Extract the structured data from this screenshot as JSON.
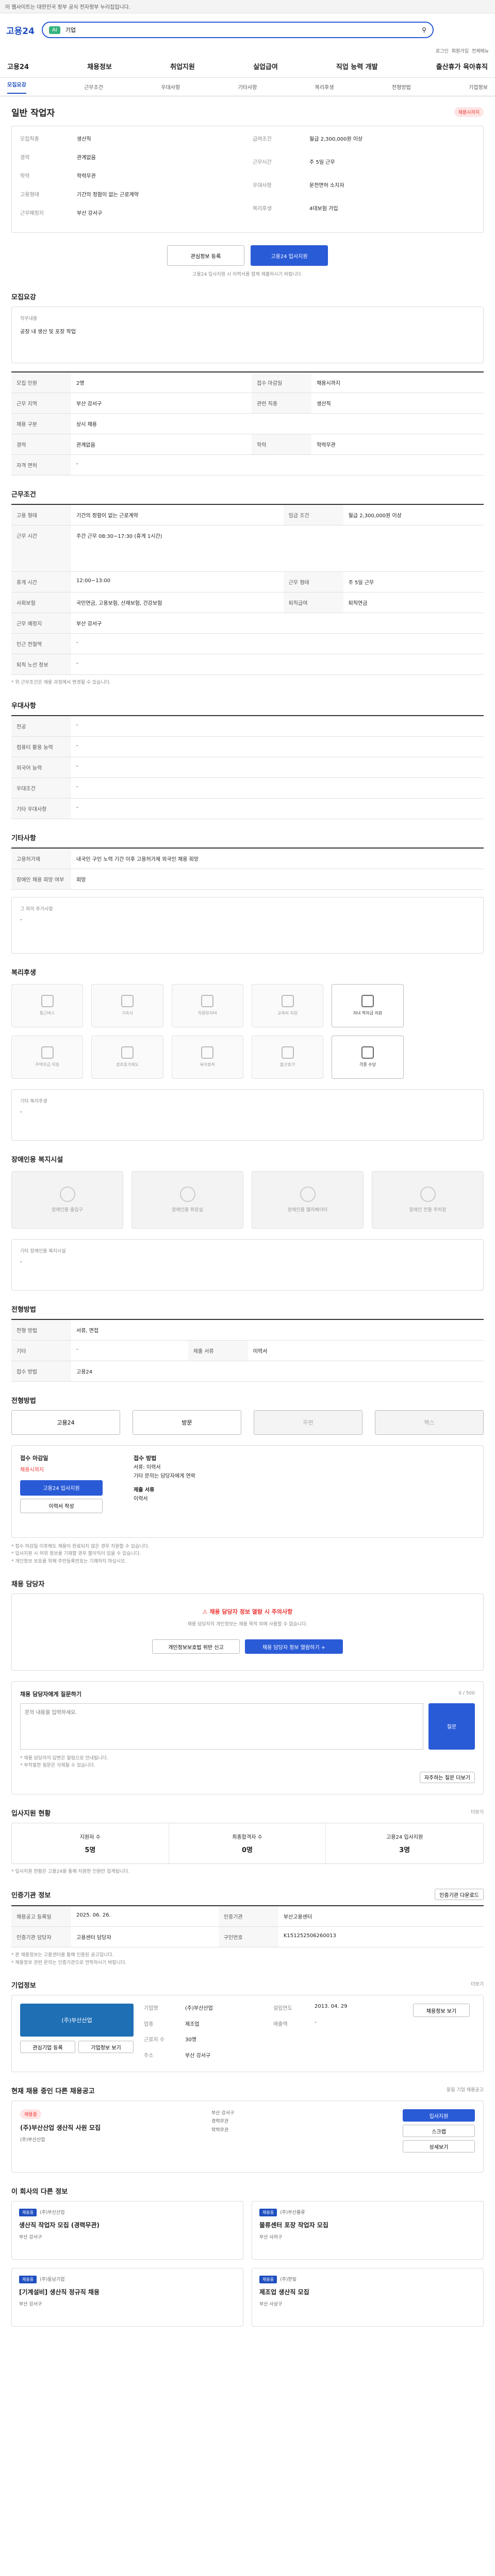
{
  "topbar": {
    "text": "이 웹사이트는 대한민국 정부 공식 전자정부 누리집입니다."
  },
  "header": {
    "logo": "고용24",
    "search_badge": "AI",
    "search_value": "기업",
    "links": [
      "로그인",
      "회원가입",
      "전체메뉴"
    ]
  },
  "nav": [
    "고용24",
    "채용정보",
    "취업지원",
    "실업급여",
    "직업 능력 개발",
    "출산휴가 육아휴직"
  ],
  "tabs": [
    "모집요강",
    "근무조건",
    "우대사항",
    "기타사항",
    "복리후생",
    "전형방법",
    "기업정보"
  ],
  "title": {
    "section": "모집요강",
    "job": "일반 작업자",
    "badge": "채용시까지"
  },
  "summary": {
    "left": [
      {
        "k": "모집직종",
        "v": "생산직"
      },
      {
        "k": "경력",
        "v": "관계없음"
      },
      {
        "k": "학력",
        "v": "학력무관"
      },
      {
        "k": "고용형태",
        "v": "기간의 정함이 없는 근로계약"
      },
      {
        "k": "근무예정지",
        "v": "부산 강서구"
      }
    ],
    "right": [
      {
        "k": "급여조건",
        "v": "월급 2,300,000원 이상"
      },
      {
        "k": "근무시간",
        "v": "주 5일 근무"
      },
      {
        "k": "우대사항",
        "v": "운전면허 소지자"
      },
      {
        "k": "복리후생",
        "v": "4대보험 가입"
      }
    ]
  },
  "actions": {
    "scrap": "관심정보 등록",
    "apply": "고용24 입사지원",
    "note": "고용24 입사지원 시 이력서를 함께 제출하시기 바랍니다."
  },
  "recruit": {
    "section": "모집요강",
    "rows": [
      {
        "k": "직무내용",
        "v": "공장 내 생산 및 포장 작업"
      },
      {
        "k": "모집 인원",
        "v": "2명"
      },
      {
        "k": "접수 마감일",
        "v": "채용시까지"
      },
      {
        "k": "근무 지역",
        "v": "부산 강서구"
      },
      {
        "k": "관련 직종",
        "v": "생산직"
      },
      {
        "k": "채용 구분",
        "v": "상시 채용"
      },
      {
        "k": "경력",
        "v": "관계없음"
      },
      {
        "k": "학력",
        "v": "학력무관"
      },
      {
        "k": "자격 면허",
        "v": "-"
      }
    ]
  },
  "work": {
    "section": "근무조건",
    "rows": [
      {
        "k": "고용 형태",
        "v": "기간의 정함이 없는 근로계약"
      },
      {
        "k": "임금 조건",
        "v": "월급 2,300,000원 이상"
      },
      {
        "k": "근무 시간",
        "v": "주간 근무 08:30~17:30 (휴게 1시간)"
      },
      {
        "k": "휴게 시간",
        "v": "12:00~13:00"
      },
      {
        "k": "근무 형태",
        "v": "주 5일 근무"
      },
      {
        "k": "사회보험",
        "v": "국민연금, 고용보험, 산재보험, 건강보험"
      },
      {
        "k": "퇴직급여",
        "v": "퇴직연금"
      },
      {
        "k": "근무 예정지",
        "v": "부산 강서구"
      },
      {
        "k": "인근 전철역",
        "v": "-"
      },
      {
        "k": "퇴직 노선 정보",
        "v": "-"
      }
    ],
    "note": "* 위 근무조건은 채용 과정에서 변경될 수 있습니다."
  },
  "prefer": {
    "section": "우대사항",
    "rows": [
      {
        "k": "전공",
        "v": "-"
      },
      {
        "k": "컴퓨터 활용 능력",
        "v": "-"
      },
      {
        "k": "외국어 능력",
        "v": "-"
      },
      {
        "k": "우대조건",
        "v": "-"
      },
      {
        "k": "기타 우대사항",
        "v": "-"
      }
    ]
  },
  "etc": {
    "section": "기타사항",
    "rows": [
      {
        "k": "고용허가제",
        "v": "내국인 구인 노력 기간 이후 고용허가제 외국인 채용 희망"
      },
      {
        "k": "장애인 채용 희망 여부",
        "v": "희망"
      }
    ],
    "other_label": "그 외의 추가사항",
    "other_value": "-"
  },
  "welfare": {
    "section": "복리후생",
    "items": [
      "통근버스",
      "기숙사",
      "차량유지비",
      "교육비 지원",
      "자녀 학자금 지원",
      "주택자금 지원",
      "경조휴가제도",
      "육아휴직",
      "출산휴가",
      "각종 수당"
    ],
    "on": [
      4,
      9
    ],
    "other_label": "기타 복리후생",
    "other_value": "-"
  },
  "disability": {
    "section": "장애인용 복지시설",
    "items": [
      "장애인용 출입구",
      "장애인용 화장실",
      "장애인용 엘리베이터",
      "장애인 전용 주차장"
    ],
    "other_label": "기타 장애인용 복지시설",
    "other_value": "-"
  },
  "process": {
    "section": "전형방법",
    "rows": [
      {
        "k": "전형 방법",
        "v": "서류, 면접"
      },
      {
        "k": "기타",
        "v": "-"
      },
      {
        "k": "제출 서류",
        "v": "이력서"
      },
      {
        "k": "접수 방법",
        "v": "고용24"
      }
    ]
  },
  "apply": {
    "section": "전형방법",
    "methods": [
      "고용24",
      "방문",
      "우편",
      "팩스"
    ],
    "enabled": [
      0,
      1
    ],
    "left_title": "접수 마감일",
    "left_deadline": "채용시까지",
    "left_btn1": "고용24 입사지원",
    "left_btn2": "이력서 작성",
    "right_title": "접수 방법",
    "right_lines": [
      "서류: 이력서",
      "기타 문의는 담당자에게 연락"
    ],
    "right_sub": "제출 서류",
    "right_sub_value": "이력서",
    "notes": [
      "* 접수 마감일 이후에도 채용이 완료되지 않은 경우 지원할 수 있습니다.",
      "* 입사지원 시 허위 정보를 기재할 경우 불이익이 있을 수 있습니다.",
      "* 개인정보 보호를 위해 주민등록번호는 기재하지 마십시오."
    ]
  },
  "contact": {
    "section": "채용 담당자",
    "warn_title": "채용 담당자 정보 열람 시 주의사항",
    "warn_text": "채용 담당자의 개인정보는 채용 목적 외에 사용할 수 없습니다.",
    "btn1": "개인정보보호법 위반 신고",
    "btn2": "채용 담당자 정보 열람하기 +"
  },
  "qna": {
    "title": "채용 담당자에게 질문하기",
    "counter": "0 / 500",
    "placeholder": "문의 내용을 입력하세요.",
    "submit": "질문",
    "notes": [
      "* 채용 담당자의 답변은 알림으로 안내됩니다.",
      "* 부적절한 질문은 삭제될 수 있습니다."
    ],
    "more": "자주하는 질문 더보기"
  },
  "stats": {
    "section": "입사지원 현황",
    "more": "더보기",
    "items": [
      {
        "k": "지원자 수",
        "v": "5명"
      },
      {
        "k": "최종합격자 수",
        "v": "0명"
      },
      {
        "k": "고용24 입사지원",
        "v": "3명"
      }
    ],
    "note": "* 입사지원 현황은 고용24를 통해 지원한 인원만 집계됩니다."
  },
  "agency": {
    "section": "인증기관 정보",
    "btn": "인증기관 다운로드",
    "rows": [
      {
        "k": "채용공고 등록일",
        "v": "2025. 06. 26."
      },
      {
        "k": "인증기관",
        "v": "부산고용센터"
      },
      {
        "k": "인증기관 담당자",
        "v": "고용센터 담당자"
      },
      {
        "k": "구인번호",
        "v": "K151252506260013"
      }
    ],
    "notes": [
      "* 본 채용정보는 고용센터를 통해 인증된 공고입니다.",
      "* 채용정보 관련 문의는 인증기관으로 연락하시기 바랍니다."
    ]
  },
  "company": {
    "section": "기업정보",
    "more": "더보기",
    "logo_text": "(주)부산산업",
    "btns": [
      "관심기업 등록",
      "기업정보 보기"
    ],
    "rows": [
      {
        "k": "기업명",
        "v": "(주)부산산업"
      },
      {
        "k": "업종",
        "v": "제조업"
      },
      {
        "k": "근로자 수",
        "v": "30명"
      },
      {
        "k": "주소",
        "v": "부산 강서구"
      },
      {
        "k": "설립연도",
        "v": "2013. 04. 29"
      },
      {
        "k": "매출액",
        "v": "-"
      }
    ],
    "btn_more": "채용정보 보기"
  },
  "other": {
    "section": "현재 채용 중인 다른 채용공고",
    "note": "동일 기업 채용공고",
    "tag": "채용중",
    "title": "(주)부산산업 생산직 사원 모집",
    "company": "(주)부산산업",
    "mini": [
      "부산 강서구",
      "경력무관",
      "학력무관"
    ],
    "btns": [
      "입사지원",
      "스크랩",
      "상세보기"
    ]
  },
  "similar": {
    "section": "이 회사의 다른 정보",
    "cards": [
      {
        "tag": "채용중",
        "company": "(주)부산산업",
        "title": "생산직 작업자 모집 (경력무관)",
        "mini": "부산 강서구"
      },
      {
        "tag": "채용중",
        "company": "(주)부산물류",
        "title": "물류센터 포장 작업자 모집",
        "mini": "부산 사하구"
      },
      {
        "tag": "채용중",
        "company": "(주)동남기업",
        "title": "[기계설비] 생산직 정규직 채용",
        "mini": "부산 강서구"
      },
      {
        "tag": "채용중",
        "company": "(주)한빛",
        "title": "제조업 생산직 모집",
        "mini": "부산 사상구"
      }
    ]
  }
}
